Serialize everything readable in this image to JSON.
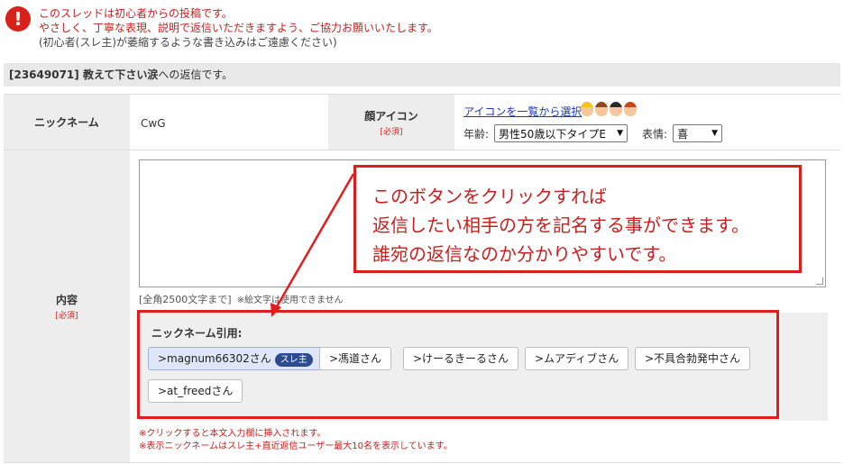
{
  "notice": {
    "line1": "このスレッドは初心者からの投稿です。",
    "line2": "やさしく、丁寧な表現、説明で返信いただきますよう、ご協力お願いいたします。",
    "line3": "(初心者(スレ主)が萎縮するような書き込みはご遠慮ください)"
  },
  "reply_bar": {
    "thread": "[23649071] 教えて下さい涙",
    "suffix": "への返信です。"
  },
  "form": {
    "nickname_label": "ニックネーム",
    "nickname_value": "CwG",
    "face_label": "顔アイコン",
    "required": "[必須]",
    "icon_link": "アイコンを一覧から選択",
    "age_label": "年齢:",
    "age_value": "男性50歳以下タイプE",
    "expression_label": "表情:",
    "expression_value": "喜",
    "content_label": "内容",
    "char_note": "[全角2500文字まで]",
    "char_note2": "※絵文字は使用できません"
  },
  "quote": {
    "title": "ニックネーム引用:",
    "badge": "スレ主",
    "chips": [
      ">magnum66302さん",
      ">馮道さん",
      ">けーるきーるさん",
      ">ムアディブさん",
      ">不具合勃発中さん",
      ">at_freedさん"
    ]
  },
  "footnotes": {
    "line1": "※クリックすると本文入力欄に挿入されます。",
    "line2": "※表示ニックネームはスレ主+直近返信ユーザー最大10名を表示しています。"
  },
  "callout": {
    "line1": "このボタンをクリックすれば",
    "line2": "返信したい相手の方を記名する事ができます。",
    "line3": "誰宛の返信なのか分かりやすいです。"
  },
  "colors": {
    "alert_red": "#d9211b",
    "link_blue": "#1a3ab8",
    "annotation_red": "#e01e1e"
  },
  "icons": [
    "error-icon",
    "face-icon"
  ]
}
